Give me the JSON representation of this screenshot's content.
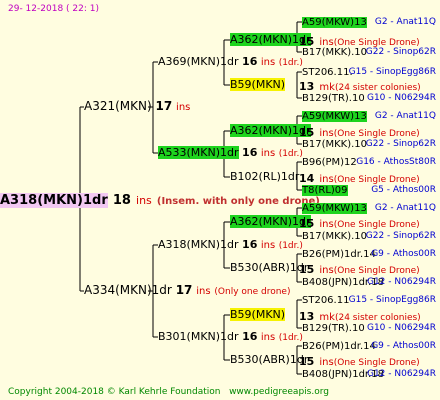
{
  "header": {
    "date": "29- 12-2018 ( 22:  1)"
  },
  "footer": {
    "copyright": "Copyright 2004-2018 © Karl Kehrle Foundation",
    "url": "www.pedigreeapis.org"
  },
  "colors": {
    "line": "#000000",
    "green": "#1ed41e",
    "yellow": "#f6f200",
    "pink": "#f2c8f2",
    "red": "#d40000",
    "blue": "#0000d0"
  },
  "root": {
    "name": "A318(MKN)1dr",
    "gen": "18",
    "ins": "ins",
    "note": " (Insem. with only one drone)"
  },
  "g1": {
    "top": {
      "name": "A321(MKN)",
      "gen": "17",
      "ins": "ins"
    },
    "bottom": {
      "name": "A334(MKN)1dr",
      "gen": "17",
      "ins": "ins",
      "note": "(Only one drone)"
    }
  },
  "g2": [
    {
      "name": "A369(MKN)1dr",
      "gen": "16",
      "ins": "ins",
      "note": "(1dr.)"
    },
    {
      "name": "A533(MKN)1dr",
      "gen": "16",
      "ins": "ins",
      "note": "(1dr.)"
    },
    {
      "name": "A318(MKN)1dr",
      "gen": "16",
      "ins": "ins",
      "note": "(1dr.)"
    },
    {
      "name": "B301(MKN)1dr",
      "gen": "16",
      "ins": "ins",
      "note": "(1dr.)"
    }
  ],
  "g3": [
    {
      "name": "A362(MKN)1dr",
      "gen": "15",
      "ins": "ins",
      "note": "(One Single Drone)"
    },
    {
      "name": "B59(MKN)",
      "gen": "13",
      "ins": "mk",
      "note": "(24 sister colonies)"
    },
    {
      "name": "A362(MKN)1dr",
      "gen": "15",
      "ins": "ins",
      "note": "(One Single Drone)"
    },
    {
      "name": "B102(RL)1dr",
      "gen": "14",
      "ins": "ins",
      "note": "(One Single Drone)"
    },
    {
      "name": "A362(MKN)1dr",
      "gen": "15",
      "ins": "ins",
      "note": "(One Single Drone)"
    },
    {
      "name": "B530(ABR)1dr",
      "gen": "15",
      "ins": "ins",
      "note": "(One Single Drone)"
    },
    {
      "name": "B59(MKN)",
      "gen": "13",
      "ins": "mk",
      "note": "(24 sister colonies)"
    },
    {
      "name": "B530(ABR)1dr",
      "gen": "15",
      "ins": "ins",
      "note": "(One Single Drone)"
    }
  ],
  "g4": [
    {
      "name": "A59(MKW)13",
      "right": "G2 - Anat11Q"
    },
    {
      "name": "B17(MKK).10",
      "right": "G22 - Sinop62R"
    },
    {
      "name": "ST206.11.",
      "right": "G15 - SinopEgg86R"
    },
    {
      "name": "B129(TR).10",
      "right": "G10 - N06294R"
    },
    {
      "name": "A59(MKW)13",
      "right": "G2 - Anat11Q"
    },
    {
      "name": "B17(MKK).10",
      "right": "G22 - Sinop62R"
    },
    {
      "name": "B96(PM)12",
      "right": "G16 - AthosSt80R"
    },
    {
      "name": "T8(RL)09",
      "right": "G5 - Athos00R"
    },
    {
      "name": "A59(MKW)13",
      "right": "G2 - Anat11Q"
    },
    {
      "name": "B17(MKK).10",
      "right": "G22 - Sinop62R"
    },
    {
      "name": "B26(PM)1dr.14",
      "right": "G9 - Athos00R"
    },
    {
      "name": "B408(JPN)1dr.18",
      "right": "G12 - N06294R"
    },
    {
      "name": "ST206.11",
      "right": "G15 - SinopEgg86R"
    },
    {
      "name": "B129(TR).10",
      "right": "G10 - N06294R"
    },
    {
      "name": "B26(PM)1dr.14",
      "right": "G9 - Athos00R"
    },
    {
      "name": "B408(JPN)1dr.18",
      "right": "G12 - N06294R"
    }
  ]
}
